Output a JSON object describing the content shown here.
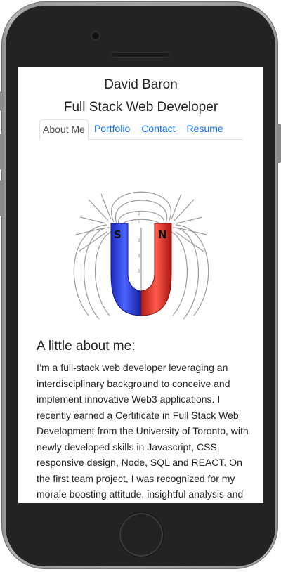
{
  "header": {
    "name": "David Baron",
    "title": "Full Stack Web Developer"
  },
  "tabs": [
    {
      "label": "About Me",
      "active": true
    },
    {
      "label": "Portfolio",
      "active": false
    },
    {
      "label": "Contact",
      "active": false
    },
    {
      "label": "Resume",
      "active": false
    }
  ],
  "hero": {
    "icon": "horseshoe-magnet",
    "south_label": "S",
    "north_label": "N",
    "colors": {
      "south": "#2a3fe0",
      "north": "#e83a2f"
    }
  },
  "about": {
    "heading": "A little about me:",
    "paragraph": "I’m a full-stack web developer leveraging an interdisciplinary background to conceive and implement innovative Web3 applications. I recently earned a Certificate in Full Stack Web Development from the University of Toronto, with newly developed skills in Javascript, CSS, responsive design, Node, SQL and REACT. On the first team project, I was recognized for my morale boosting attitude, insightful analysis and inspirational vision. I’m dedicated to"
  },
  "colors": {
    "link": "#0d6efd",
    "text": "#222222",
    "device_frame": "#232323"
  }
}
